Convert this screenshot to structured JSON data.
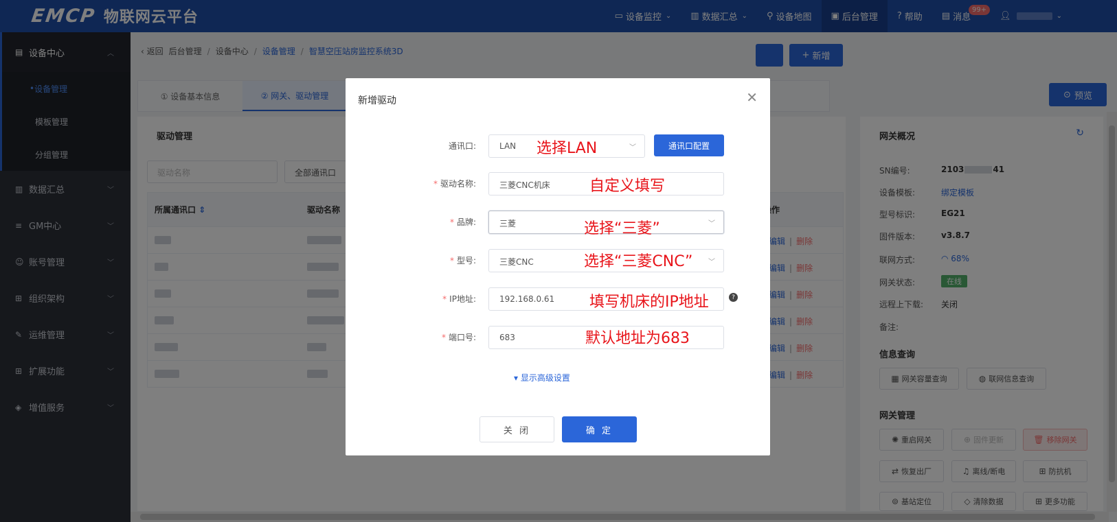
{
  "header": {
    "logo": "EMCP",
    "platform_name": "物联网云平台",
    "nav": [
      {
        "label": "设备监控",
        "icon": "monitor-icon",
        "chevron": true
      },
      {
        "label": "数据汇总",
        "icon": "chart-icon",
        "chevron": true
      },
      {
        "label": "设备地图",
        "icon": "map-pin-icon",
        "chevron": false
      },
      {
        "label": "后台管理",
        "icon": "admin-icon",
        "chevron": false,
        "active": true
      },
      {
        "label": "帮助",
        "icon": "help-icon",
        "chevron": false
      },
      {
        "label": "消息",
        "icon": "message-icon",
        "chevron": false,
        "badge": "99+"
      }
    ]
  },
  "sidebar": {
    "groups": [
      {
        "label": "设备中心",
        "open": true,
        "children": [
          {
            "label": "设备管理",
            "active": true
          },
          {
            "label": "模板管理"
          },
          {
            "label": "分组管理"
          }
        ]
      },
      {
        "label": "数据汇总"
      },
      {
        "label": "GM中心"
      },
      {
        "label": "账号管理"
      },
      {
        "label": "组织架构"
      },
      {
        "label": "运维管理"
      },
      {
        "label": "扩展功能"
      },
      {
        "label": "增值服务"
      }
    ]
  },
  "breadcrumb": {
    "back": "返回",
    "items": [
      "后台管理",
      "设备中心",
      "设备管理",
      "智慧空压站房监控系统3D"
    ]
  },
  "tabs": [
    "① 设备基本信息",
    "② 网关、驱动管理"
  ],
  "preview_label": "预览",
  "driver_panel": {
    "title": "驱动管理",
    "search_placeholder": "驱动名称",
    "port_filter": "全部通讯口",
    "add_label": "新增",
    "columns": [
      "所属通讯口",
      "驱动名称",
      "操作"
    ],
    "row_ops": {
      "edit": "编辑",
      "delete": "删除"
    },
    "row_count": 6
  },
  "gateway": {
    "title": "网关概况",
    "fields": [
      {
        "label": "SN编号:",
        "value": "2103",
        "value_tail": "41",
        "style": "bold"
      },
      {
        "label": "设备模板:",
        "value": "绑定模板",
        "style": "link"
      },
      {
        "label": "型号标识:",
        "value": "EG21",
        "style": "bold"
      },
      {
        "label": "固件版本:",
        "value": "v3.8.7",
        "style": "bold"
      },
      {
        "label": "联网方式:",
        "value": "68%",
        "style": "link"
      },
      {
        "label": "网关状态:",
        "value": "在线",
        "style": "tag"
      },
      {
        "label": "远程上下载:",
        "value": "关闭",
        "style": "plain"
      },
      {
        "label": "备注:",
        "value": "",
        "style": "plain"
      }
    ],
    "info_title": "信息查询",
    "info_buttons": [
      "网关容量查询",
      "联网信息查询"
    ],
    "manage_title": "网关管理",
    "manage_buttons": [
      "重启网关",
      "固件更新",
      "移除网关",
      "恢复出厂",
      "离线/断电",
      "防抗机",
      "基站定位",
      "清除数据",
      "更多功能"
    ]
  },
  "modal": {
    "title": "新增驱动",
    "fields": {
      "port": {
        "label": "通讯口:",
        "value": "LAN",
        "required": false
      },
      "name": {
        "label": "驱动名称:",
        "value": "三菱CNC机床",
        "required": true
      },
      "brand": {
        "label": "品牌:",
        "value": "三菱",
        "required": true
      },
      "model": {
        "label": "型号:",
        "value": "三菱CNC",
        "required": true
      },
      "ip": {
        "label": "IP地址:",
        "value": "192.168.0.61",
        "required": true
      },
      "port_no": {
        "label": "端口号:",
        "value": "683",
        "required": true
      }
    },
    "port_config_label": "通讯口配置",
    "advanced_label": "显示高级设置",
    "cancel_label": "关 闭",
    "ok_label": "确 定"
  },
  "annotations": [
    "选择LAN",
    "自定义填写",
    "选择“三菱”",
    "选择“三菱CNC”",
    "填写机床的IP地址",
    "默认地址为683"
  ],
  "colors": {
    "header_bg": "#1f4fa8",
    "primary": "#2b66d9",
    "sidebar_bg": "#2d3039",
    "danger": "#f56c6c",
    "success": "#52b16b",
    "annotation": "#e8141a"
  }
}
